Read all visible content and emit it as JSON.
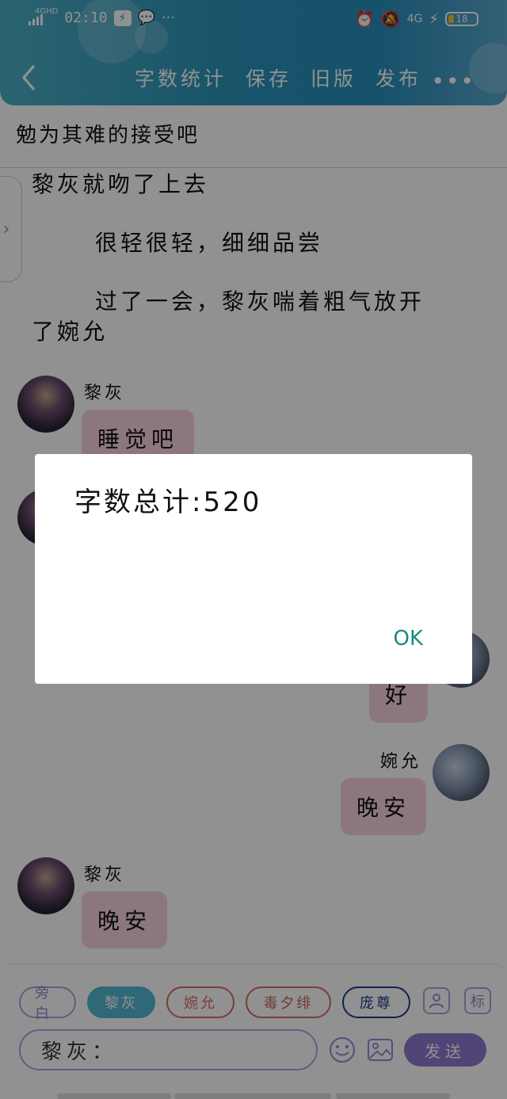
{
  "status": {
    "network": "4GHD",
    "time": "02:10",
    "more": "···",
    "right_net": "4G",
    "battery": "18"
  },
  "nav": {
    "actions": [
      "字数统计",
      "保存",
      "旧版",
      "发布"
    ],
    "more": "•••"
  },
  "content": {
    "top_line": "勉为其难的接受吧",
    "narration": [
      "黎灰就吻了上去",
      "很轻很轻，细细品尝",
      "过了一会，黎灰喘着粗气放开",
      "了婉允"
    ],
    "messages": [
      {
        "name": "黎灰",
        "text": "睡觉吧",
        "side": "left"
      },
      {
        "name": "",
        "text": "好",
        "side": "right"
      },
      {
        "name": "婉允",
        "text": "晚安",
        "side": "right"
      },
      {
        "name": "黎灰",
        "text": "晚安",
        "side": "left"
      }
    ]
  },
  "dialog": {
    "message": "字数总计:520",
    "ok": "OK"
  },
  "composer": {
    "chips": [
      "旁白",
      "黎灰",
      "婉允",
      "毒夕绯",
      "庞尊"
    ],
    "badge_label": "标",
    "input_value": "黎灰：",
    "send": "发送"
  },
  "colors": {
    "header_start": "#4db0c6",
    "header_end": "#2a8fbd",
    "bubble": "#f6d3db",
    "accent_purple": "#8f7ad2",
    "ok_teal": "#1a8a7f"
  },
  "icons": [
    "back-icon",
    "more-icon",
    "emoji-icon",
    "image-icon",
    "person-icon"
  ]
}
